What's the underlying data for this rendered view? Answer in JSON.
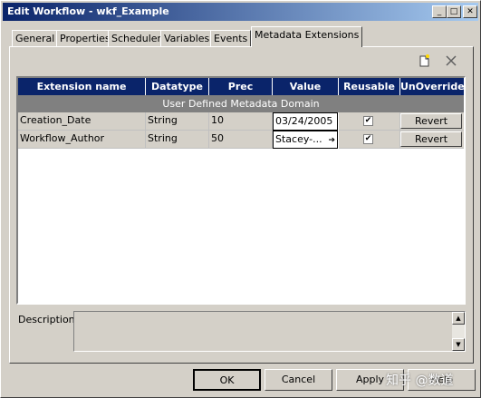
{
  "window": {
    "title": "Edit Workflow - wkf_Example"
  },
  "tabs": [
    {
      "label": "General"
    },
    {
      "label": "Properties"
    },
    {
      "label": "Scheduler"
    },
    {
      "label": "Variables"
    },
    {
      "label": "Events"
    },
    {
      "label": "Metadata Extensions"
    }
  ],
  "active_tab": "Metadata Extensions",
  "table": {
    "columns": [
      "Extension name",
      "Datatype",
      "Prec",
      "Value",
      "Reusable",
      "UnOverride"
    ],
    "domain_label": "User Defined Metadata Domain",
    "rows": [
      {
        "name": "Creation_Date",
        "datatype": "String",
        "prec": "10",
        "value": "03/24/2005",
        "reusable": true,
        "action": "Revert"
      },
      {
        "name": "Workflow_Author",
        "datatype": "String",
        "prec": "50",
        "value": "Stacey-...",
        "reusable": true,
        "action": "Revert"
      }
    ]
  },
  "description": {
    "label": "Description:",
    "value": ""
  },
  "buttons": {
    "ok": "OK",
    "cancel": "Cancel",
    "apply": "Apply",
    "help": "Help"
  },
  "watermark": "知乎 @数道",
  "icons": [
    "new-document-icon",
    "delete-x-icon",
    "minimize-icon",
    "maximize-icon",
    "close-icon",
    "check-icon",
    "dropdown-arrow-icon",
    "scroll-up-icon",
    "scroll-down-icon"
  ]
}
